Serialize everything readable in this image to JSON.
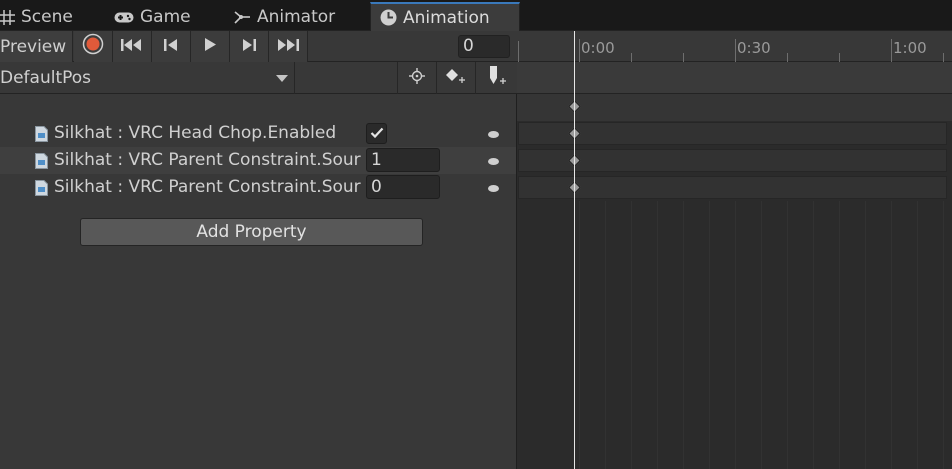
{
  "tabs": [
    {
      "label": "Scene",
      "icon": "scene-grid-icon"
    },
    {
      "label": "Game",
      "icon": "gamepad-icon"
    },
    {
      "label": "Animator",
      "icon": "animator-icon"
    },
    {
      "label": "Animation",
      "icon": "clock-icon",
      "active": true
    }
  ],
  "toolbar": {
    "preview_label": "Preview",
    "frame_value": "0",
    "buttons": [
      "record-button",
      "first-keyframe-button",
      "prev-keyframe-button",
      "play-button",
      "next-keyframe-button",
      "last-keyframe-button"
    ]
  },
  "clip": {
    "selected": "DefaultPos",
    "buttons": [
      "filter-by-selection-button",
      "add-keyframe-button",
      "add-event-button"
    ]
  },
  "properties": [
    {
      "name": "Silkhat : VRC Head Chop.Enabled",
      "type": "checkbox",
      "checked": true
    },
    {
      "name": "Silkhat : VRC Parent Constraint.Sour",
      "type": "number",
      "value": "1"
    },
    {
      "name": "Silkhat : VRC Parent Constraint.Sour",
      "type": "number",
      "value": "0"
    }
  ],
  "add_property_label": "Add Property",
  "timeline": {
    "ticks": [
      "0:00",
      "0:30",
      "1:00"
    ],
    "current_time": "0:00"
  },
  "colors": {
    "accent": "#3a79bb",
    "record": "#e05a3a",
    "background": "#383838",
    "timeline": "#2b2b2b"
  }
}
